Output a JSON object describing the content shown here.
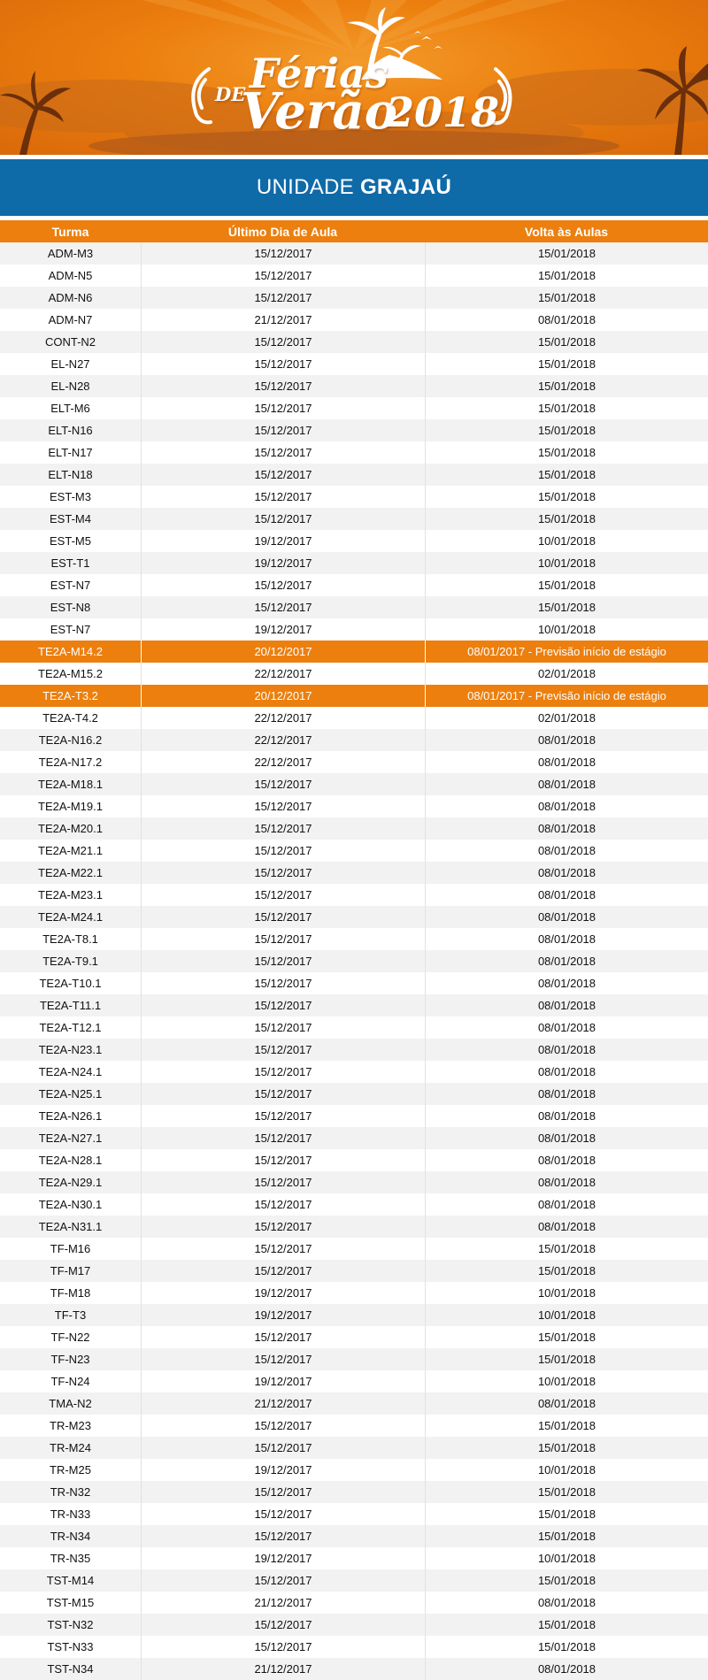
{
  "banner": {
    "title_de": "DE",
    "title_ferias": "Férias",
    "title_verao": "Verão",
    "title_year": "2018",
    "bg_color": "#ec7f0e"
  },
  "unit": {
    "prefix": "UNIDADE",
    "name": "GRAJAÚ",
    "bg_color": "#0f6aa8"
  },
  "table": {
    "headers": [
      "Turma",
      "Último Dia de Aula",
      "Volta às Aulas"
    ],
    "highlight_color": "#ec7f0e",
    "rows": [
      {
        "turma": "ADM-M3",
        "ultimo": "15/12/2017",
        "volta": "15/01/2018"
      },
      {
        "turma": "ADM-N5",
        "ultimo": "15/12/2017",
        "volta": "15/01/2018"
      },
      {
        "turma": "ADM-N6",
        "ultimo": "15/12/2017",
        "volta": "15/01/2018"
      },
      {
        "turma": "ADM-N7",
        "ultimo": "21/12/2017",
        "volta": "08/01/2018"
      },
      {
        "turma": "CONT-N2",
        "ultimo": "15/12/2017",
        "volta": "15/01/2018"
      },
      {
        "turma": "EL-N27",
        "ultimo": "15/12/2017",
        "volta": "15/01/2018"
      },
      {
        "turma": "EL-N28",
        "ultimo": "15/12/2017",
        "volta": "15/01/2018"
      },
      {
        "turma": "ELT-M6",
        "ultimo": "15/12/2017",
        "volta": "15/01/2018"
      },
      {
        "turma": "ELT-N16",
        "ultimo": "15/12/2017",
        "volta": "15/01/2018"
      },
      {
        "turma": "ELT-N17",
        "ultimo": "15/12/2017",
        "volta": "15/01/2018"
      },
      {
        "turma": "ELT-N18",
        "ultimo": "15/12/2017",
        "volta": "15/01/2018"
      },
      {
        "turma": "EST-M3",
        "ultimo": "15/12/2017",
        "volta": "15/01/2018"
      },
      {
        "turma": "EST-M4",
        "ultimo": "15/12/2017",
        "volta": "15/01/2018"
      },
      {
        "turma": "EST-M5",
        "ultimo": "19/12/2017",
        "volta": "10/01/2018"
      },
      {
        "turma": "EST-T1",
        "ultimo": "19/12/2017",
        "volta": "10/01/2018"
      },
      {
        "turma": "EST-N7",
        "ultimo": "15/12/2017",
        "volta": "15/01/2018"
      },
      {
        "turma": "EST-N8",
        "ultimo": "15/12/2017",
        "volta": "15/01/2018"
      },
      {
        "turma": "EST-N7",
        "ultimo": "19/12/2017",
        "volta": "10/01/2018"
      },
      {
        "turma": "TE2A-M14.2",
        "ultimo": "20/12/2017",
        "volta": "08/01/2017 - Previsão início de estágio",
        "highlight": true
      },
      {
        "turma": "TE2A-M15.2",
        "ultimo": "22/12/2017",
        "volta": "02/01/2018"
      },
      {
        "turma": "TE2A-T3.2",
        "ultimo": "20/12/2017",
        "volta": "08/01/2017 - Previsão início de estágio",
        "highlight": true
      },
      {
        "turma": "TE2A-T4.2",
        "ultimo": "22/12/2017",
        "volta": "02/01/2018"
      },
      {
        "turma": "TE2A-N16.2",
        "ultimo": "22/12/2017",
        "volta": "08/01/2018"
      },
      {
        "turma": "TE2A-N17.2",
        "ultimo": "22/12/2017",
        "volta": "08/01/2018"
      },
      {
        "turma": "TE2A-M18.1",
        "ultimo": "15/12/2017",
        "volta": "08/01/2018"
      },
      {
        "turma": "TE2A-M19.1",
        "ultimo": "15/12/2017",
        "volta": "08/01/2018"
      },
      {
        "turma": "TE2A-M20.1",
        "ultimo": "15/12/2017",
        "volta": "08/01/2018"
      },
      {
        "turma": "TE2A-M21.1",
        "ultimo": "15/12/2017",
        "volta": "08/01/2018"
      },
      {
        "turma": "TE2A-M22.1",
        "ultimo": "15/12/2017",
        "volta": "08/01/2018"
      },
      {
        "turma": "TE2A-M23.1",
        "ultimo": "15/12/2017",
        "volta": "08/01/2018"
      },
      {
        "turma": "TE2A-M24.1",
        "ultimo": "15/12/2017",
        "volta": "08/01/2018"
      },
      {
        "turma": "TE2A-T8.1",
        "ultimo": "15/12/2017",
        "volta": "08/01/2018"
      },
      {
        "turma": "TE2A-T9.1",
        "ultimo": "15/12/2017",
        "volta": "08/01/2018"
      },
      {
        "turma": "TE2A-T10.1",
        "ultimo": "15/12/2017",
        "volta": "08/01/2018"
      },
      {
        "turma": "TE2A-T11.1",
        "ultimo": "15/12/2017",
        "volta": "08/01/2018"
      },
      {
        "turma": "TE2A-T12.1",
        "ultimo": "15/12/2017",
        "volta": "08/01/2018"
      },
      {
        "turma": "TE2A-N23.1",
        "ultimo": "15/12/2017",
        "volta": "08/01/2018"
      },
      {
        "turma": "TE2A-N24.1",
        "ultimo": "15/12/2017",
        "volta": "08/01/2018"
      },
      {
        "turma": "TE2A-N25.1",
        "ultimo": "15/12/2017",
        "volta": "08/01/2018"
      },
      {
        "turma": "TE2A-N26.1",
        "ultimo": "15/12/2017",
        "volta": "08/01/2018"
      },
      {
        "turma": "TE2A-N27.1",
        "ultimo": "15/12/2017",
        "volta": "08/01/2018"
      },
      {
        "turma": "TE2A-N28.1",
        "ultimo": "15/12/2017",
        "volta": "08/01/2018"
      },
      {
        "turma": "TE2A-N29.1",
        "ultimo": "15/12/2017",
        "volta": "08/01/2018"
      },
      {
        "turma": "TE2A-N30.1",
        "ultimo": "15/12/2017",
        "volta": "08/01/2018"
      },
      {
        "turma": "TE2A-N31.1",
        "ultimo": "15/12/2017",
        "volta": "08/01/2018"
      },
      {
        "turma": "TF-M16",
        "ultimo": "15/12/2017",
        "volta": "15/01/2018"
      },
      {
        "turma": "TF-M17",
        "ultimo": "15/12/2017",
        "volta": "15/01/2018"
      },
      {
        "turma": "TF-M18",
        "ultimo": "19/12/2017",
        "volta": "10/01/2018"
      },
      {
        "turma": "TF-T3",
        "ultimo": "19/12/2017",
        "volta": "10/01/2018"
      },
      {
        "turma": "TF-N22",
        "ultimo": "15/12/2017",
        "volta": "15/01/2018"
      },
      {
        "turma": "TF-N23",
        "ultimo": "15/12/2017",
        "volta": "15/01/2018"
      },
      {
        "turma": "TF-N24",
        "ultimo": "19/12/2017",
        "volta": "10/01/2018"
      },
      {
        "turma": "TMA-N2",
        "ultimo": "21/12/2017",
        "volta": "08/01/2018"
      },
      {
        "turma": "TR-M23",
        "ultimo": "15/12/2017",
        "volta": "15/01/2018"
      },
      {
        "turma": "TR-M24",
        "ultimo": "15/12/2017",
        "volta": "15/01/2018"
      },
      {
        "turma": "TR-M25",
        "ultimo": "19/12/2017",
        "volta": "10/01/2018"
      },
      {
        "turma": "TR-N32",
        "ultimo": "15/12/2017",
        "volta": "15/01/2018"
      },
      {
        "turma": "TR-N33",
        "ultimo": "15/12/2017",
        "volta": "15/01/2018"
      },
      {
        "turma": "TR-N34",
        "ultimo": "15/12/2017",
        "volta": "15/01/2018"
      },
      {
        "turma": "TR-N35",
        "ultimo": "19/12/2017",
        "volta": "10/01/2018"
      },
      {
        "turma": "TST-M14",
        "ultimo": "15/12/2017",
        "volta": "15/01/2018"
      },
      {
        "turma": "TST-M15",
        "ultimo": "21/12/2017",
        "volta": "08/01/2018"
      },
      {
        "turma": "TST-N32",
        "ultimo": "15/12/2017",
        "volta": "15/01/2018"
      },
      {
        "turma": "TST-N33",
        "ultimo": "15/12/2017",
        "volta": "15/01/2018"
      },
      {
        "turma": "TST-N34",
        "ultimo": "21/12/2017",
        "volta": "08/01/2018"
      }
    ]
  }
}
